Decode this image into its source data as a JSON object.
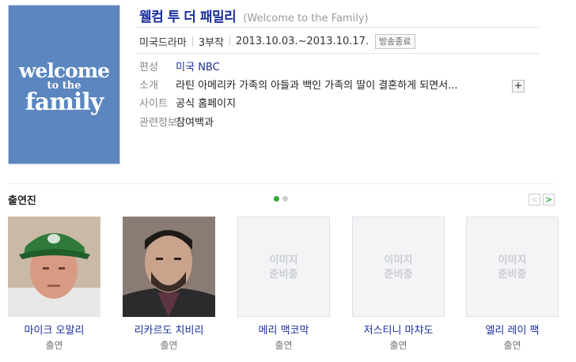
{
  "poster": {
    "line1": "welcome",
    "line2": "to the",
    "line3": "family",
    "bg": "#5b86bf"
  },
  "title": {
    "korean": "웰컴 투 더 패밀리",
    "english": "(Welcome to the Family)"
  },
  "meta": {
    "genre": "미국드라마",
    "episodes": "3부작",
    "dates": "2013.10.03.~2013.10.17.",
    "status": "방송종료"
  },
  "info": [
    {
      "label": "편성",
      "value": "미국 NBC"
    },
    {
      "label": "소개",
      "value": "라틴 아메리카 가족의 아들과 백인 가족의 딸이 결혼하게 되면서..."
    },
    {
      "label": "사이트",
      "value": "공식 홈페이지"
    },
    {
      "label": "관련정보",
      "value": "참여백과"
    }
  ],
  "more_button": "+",
  "cast": {
    "heading": "출연진",
    "prev": "<",
    "next": ">",
    "members": [
      {
        "name": "마이크 오말리",
        "role": "출연",
        "photo": "photo"
      },
      {
        "name": "리카르도 치비리",
        "role": "출연",
        "photo": "photo"
      },
      {
        "name": "메리 맥코막",
        "role": "출연",
        "placeholder": "이미지\n준비중"
      },
      {
        "name": "저스티니 마챠도",
        "role": "출연",
        "placeholder": "이미지\n준비중"
      },
      {
        "name": "엘리 레이 팩",
        "role": "출연",
        "placeholder": "이미지\n준비중"
      }
    ]
  },
  "colors": {
    "link": "#1a2e9e",
    "accent": "#31a639"
  }
}
